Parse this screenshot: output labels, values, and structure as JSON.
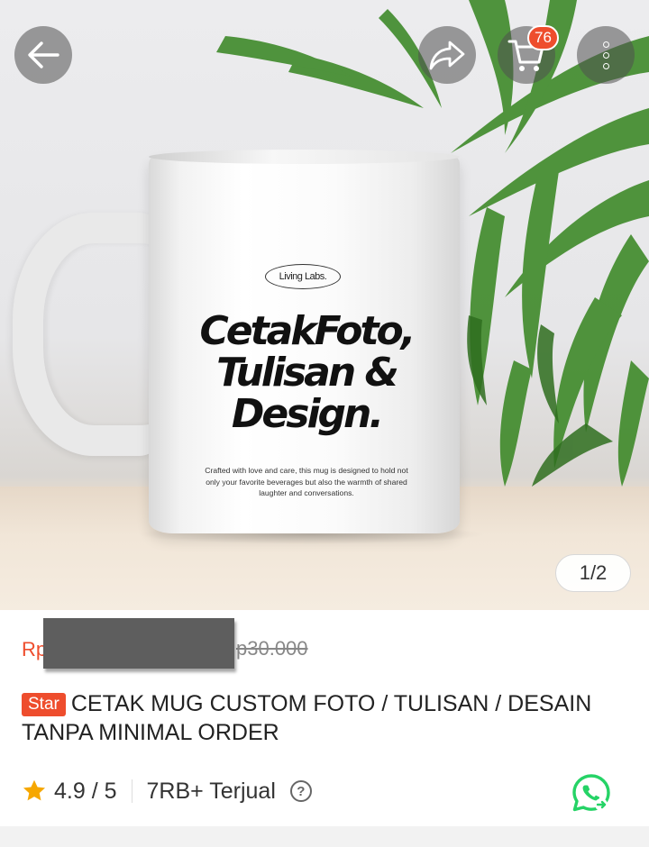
{
  "product_image": {
    "mug_brand": "Living Labs.",
    "mug_headline": [
      "CetakFoto,",
      "Tulisan &",
      "Design."
    ],
    "mug_caption": "Crafted with love and care, this mug is designed to hold not only your favorite beverages but also the warmth of shared laughter and conversations.",
    "counter": "1/2"
  },
  "top_bar": {
    "back_icon": "arrow-left-icon",
    "share_icon": "share-icon",
    "cart_icon": "cart-icon",
    "cart_badge": "76",
    "more_icon": "more-vertical-icon"
  },
  "price": {
    "current_prefix": "Rp",
    "original": "Rp30.000",
    "original_visible": "p30.000"
  },
  "title": {
    "badge": "Star",
    "text": "CETAK MUG CUSTOM FOTO / TULISAN / DESAIN TANPA MINIMAL ORDER"
  },
  "rating": {
    "value": "4.9 / 5",
    "sold": "7RB+ Terjual",
    "help_icon": "question-icon",
    "whatsapp_icon": "whatsapp-icon"
  },
  "colors": {
    "accent": "#ee4d2d",
    "star": "#f6a700",
    "whatsapp": "#25d366"
  }
}
